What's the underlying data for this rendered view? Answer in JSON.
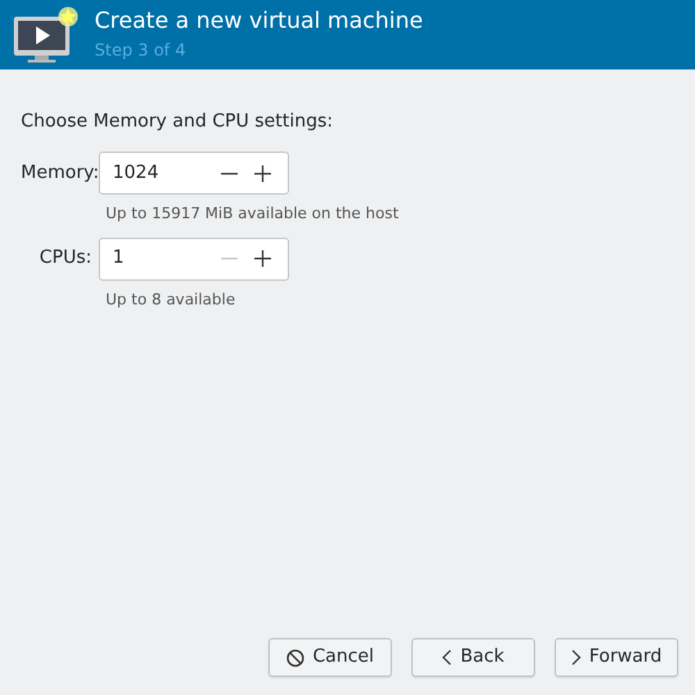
{
  "header": {
    "title": "Create a new virtual machine",
    "subtitle": "Step 3 of 4"
  },
  "prompt": "Choose Memory and CPU settings:",
  "fields": [
    {
      "label": "Memory:",
      "value": "1024",
      "decrement_disabled": false,
      "increment_disabled": false,
      "hint": "Up to 15917 MiB available on the host"
    },
    {
      "label": "CPUs:",
      "value": "1",
      "decrement_disabled": true,
      "increment_disabled": false,
      "hint": "Up to 8 available"
    }
  ],
  "buttons": [
    {
      "kind": "cancel",
      "label": "Cancel"
    },
    {
      "kind": "back",
      "label": "Back"
    },
    {
      "kind": "forward",
      "label": "Forward"
    }
  ]
}
